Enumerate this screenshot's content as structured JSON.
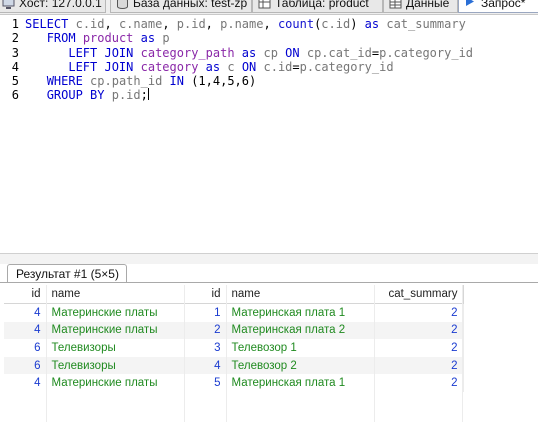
{
  "tabs": [
    {
      "label": "Хост: 127.0.0.1",
      "icon": "host-icon"
    },
    {
      "label": "База данных: test-zp",
      "icon": "database-icon"
    },
    {
      "label": "Таблица: product",
      "icon": "table-icon"
    },
    {
      "label": "Данные",
      "icon": "data-grid-icon"
    },
    {
      "label": "Запрос*",
      "icon": "query-play-icon",
      "active": true
    }
  ],
  "editor": {
    "line_numbers": [
      "1",
      "2",
      "3",
      "4",
      "5",
      "6"
    ],
    "lines": [
      [
        {
          "t": "SELECT",
          "c": "kw"
        },
        {
          "t": " ",
          "c": "pl"
        },
        {
          "t": "c.id",
          "c": "id"
        },
        {
          "t": ", ",
          "c": "pl"
        },
        {
          "t": "c.name",
          "c": "id"
        },
        {
          "t": ", ",
          "c": "pl"
        },
        {
          "t": "p.id",
          "c": "id"
        },
        {
          "t": ", ",
          "c": "pl"
        },
        {
          "t": "p.name",
          "c": "id"
        },
        {
          "t": ", ",
          "c": "pl"
        },
        {
          "t": "count",
          "c": "fn"
        },
        {
          "t": "(",
          "c": "pl"
        },
        {
          "t": "c.id",
          "c": "id"
        },
        {
          "t": ") ",
          "c": "pl"
        },
        {
          "t": "as",
          "c": "kw"
        },
        {
          "t": " ",
          "c": "pl"
        },
        {
          "t": "cat_summary",
          "c": "id"
        }
      ],
      [
        {
          "t": "   ",
          "c": "pl"
        },
        {
          "t": "FROM",
          "c": "kw"
        },
        {
          "t": " ",
          "c": "pl"
        },
        {
          "t": "product",
          "c": "tb"
        },
        {
          "t": " ",
          "c": "pl"
        },
        {
          "t": "as",
          "c": "kw"
        },
        {
          "t": " ",
          "c": "pl"
        },
        {
          "t": "p",
          "c": "id"
        }
      ],
      [
        {
          "t": "      ",
          "c": "pl"
        },
        {
          "t": "LEFT JOIN",
          "c": "kw"
        },
        {
          "t": " ",
          "c": "pl"
        },
        {
          "t": "category_path",
          "c": "tb"
        },
        {
          "t": " ",
          "c": "pl"
        },
        {
          "t": "as",
          "c": "kw"
        },
        {
          "t": " ",
          "c": "pl"
        },
        {
          "t": "cp",
          "c": "id"
        },
        {
          "t": " ",
          "c": "pl"
        },
        {
          "t": "ON",
          "c": "kw"
        },
        {
          "t": " ",
          "c": "pl"
        },
        {
          "t": "cp.cat_id",
          "c": "id"
        },
        {
          "t": "=",
          "c": "pl"
        },
        {
          "t": "p.category_id",
          "c": "id"
        }
      ],
      [
        {
          "t": "      ",
          "c": "pl"
        },
        {
          "t": "LEFT JOIN",
          "c": "kw"
        },
        {
          "t": " ",
          "c": "pl"
        },
        {
          "t": "category",
          "c": "tb"
        },
        {
          "t": " ",
          "c": "pl"
        },
        {
          "t": "as",
          "c": "kw"
        },
        {
          "t": " ",
          "c": "pl"
        },
        {
          "t": "c",
          "c": "id"
        },
        {
          "t": " ",
          "c": "pl"
        },
        {
          "t": "ON",
          "c": "kw"
        },
        {
          "t": " ",
          "c": "pl"
        },
        {
          "t": "c.id",
          "c": "id"
        },
        {
          "t": "=",
          "c": "pl"
        },
        {
          "t": "p.category_id",
          "c": "id"
        }
      ],
      [
        {
          "t": "   ",
          "c": "pl"
        },
        {
          "t": "WHERE",
          "c": "kw"
        },
        {
          "t": " ",
          "c": "pl"
        },
        {
          "t": "cp.path_id",
          "c": "id"
        },
        {
          "t": " ",
          "c": "pl"
        },
        {
          "t": "IN",
          "c": "kw"
        },
        {
          "t": " (1,4,5,6)",
          "c": "pl"
        }
      ],
      [
        {
          "t": "   ",
          "c": "pl"
        },
        {
          "t": "GROUP BY",
          "c": "kw"
        },
        {
          "t": " ",
          "c": "pl"
        },
        {
          "t": "p.id",
          "c": "id"
        },
        {
          "t": ";",
          "c": "pl"
        }
      ]
    ]
  },
  "result_tab": {
    "label": "Результат #1 (5×5)"
  },
  "grid": {
    "columns": [
      "id",
      "name",
      "id",
      "name",
      "cat_summary"
    ],
    "rows": [
      [
        "4",
        "Материнские платы",
        "1",
        "Материнская плата 1",
        "2"
      ],
      [
        "4",
        "Материнские платы",
        "2",
        "Материнская плата 2",
        "2"
      ],
      [
        "6",
        "Телевизоры",
        "3",
        "Телевозор 1",
        "2"
      ],
      [
        "6",
        "Телевизоры",
        "4",
        "Телевозор 2",
        "2"
      ],
      [
        "4",
        "Материнские платы",
        "5",
        "Материнская плата 1",
        "2"
      ]
    ]
  },
  "colors": {
    "keyword": "#0000d0",
    "table_name": "#8a28a8",
    "identifier": "#777777",
    "grid_number": "#1a3bd0",
    "grid_text": "#1f8a1f"
  }
}
